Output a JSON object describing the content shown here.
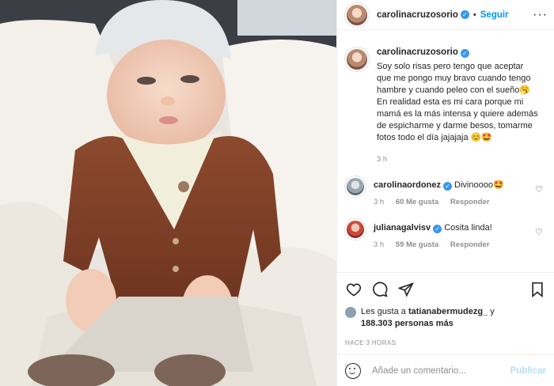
{
  "post": {
    "author": "carolinacruzosorio",
    "follow_label": "Seguir",
    "separator": "•",
    "more_icon": "more-icon",
    "caption": "Soy solo risas pero tengo que aceptar que me pongo muy bravo cuando tengo hambre y cuando peleo con el sueño🥱 En realidad esta es mi cara porque mi mamá es la más intensa y quiere además de espicharme y darme besos, tomarme fotos todo el día jajajaja 😊🤩",
    "caption_time": "3 h"
  },
  "comments": [
    {
      "user": "carolinaordonez",
      "text": "Divinoooo🤩",
      "time": "3 h",
      "likes": "60 Me gusta",
      "reply": "Responder"
    },
    {
      "user": "julianagalvisv",
      "text": "Cosita linda!",
      "time": "3 h",
      "likes": "59 Me gusta",
      "reply": "Responder"
    }
  ],
  "likes": {
    "prefix": "Les gusta a",
    "user": "tatianabermudezg_",
    "connector": "y",
    "count": "188.303 personas más"
  },
  "posted_ago": "HACE 3 HORAS",
  "add_comment": {
    "placeholder": "Añade un comentario...",
    "publish_label": "Publicar"
  },
  "colors": {
    "accent": "#0095f6",
    "verified": "#3897f0",
    "publish_disabled": "#b2dffc",
    "muted": "#8e8e8e"
  }
}
